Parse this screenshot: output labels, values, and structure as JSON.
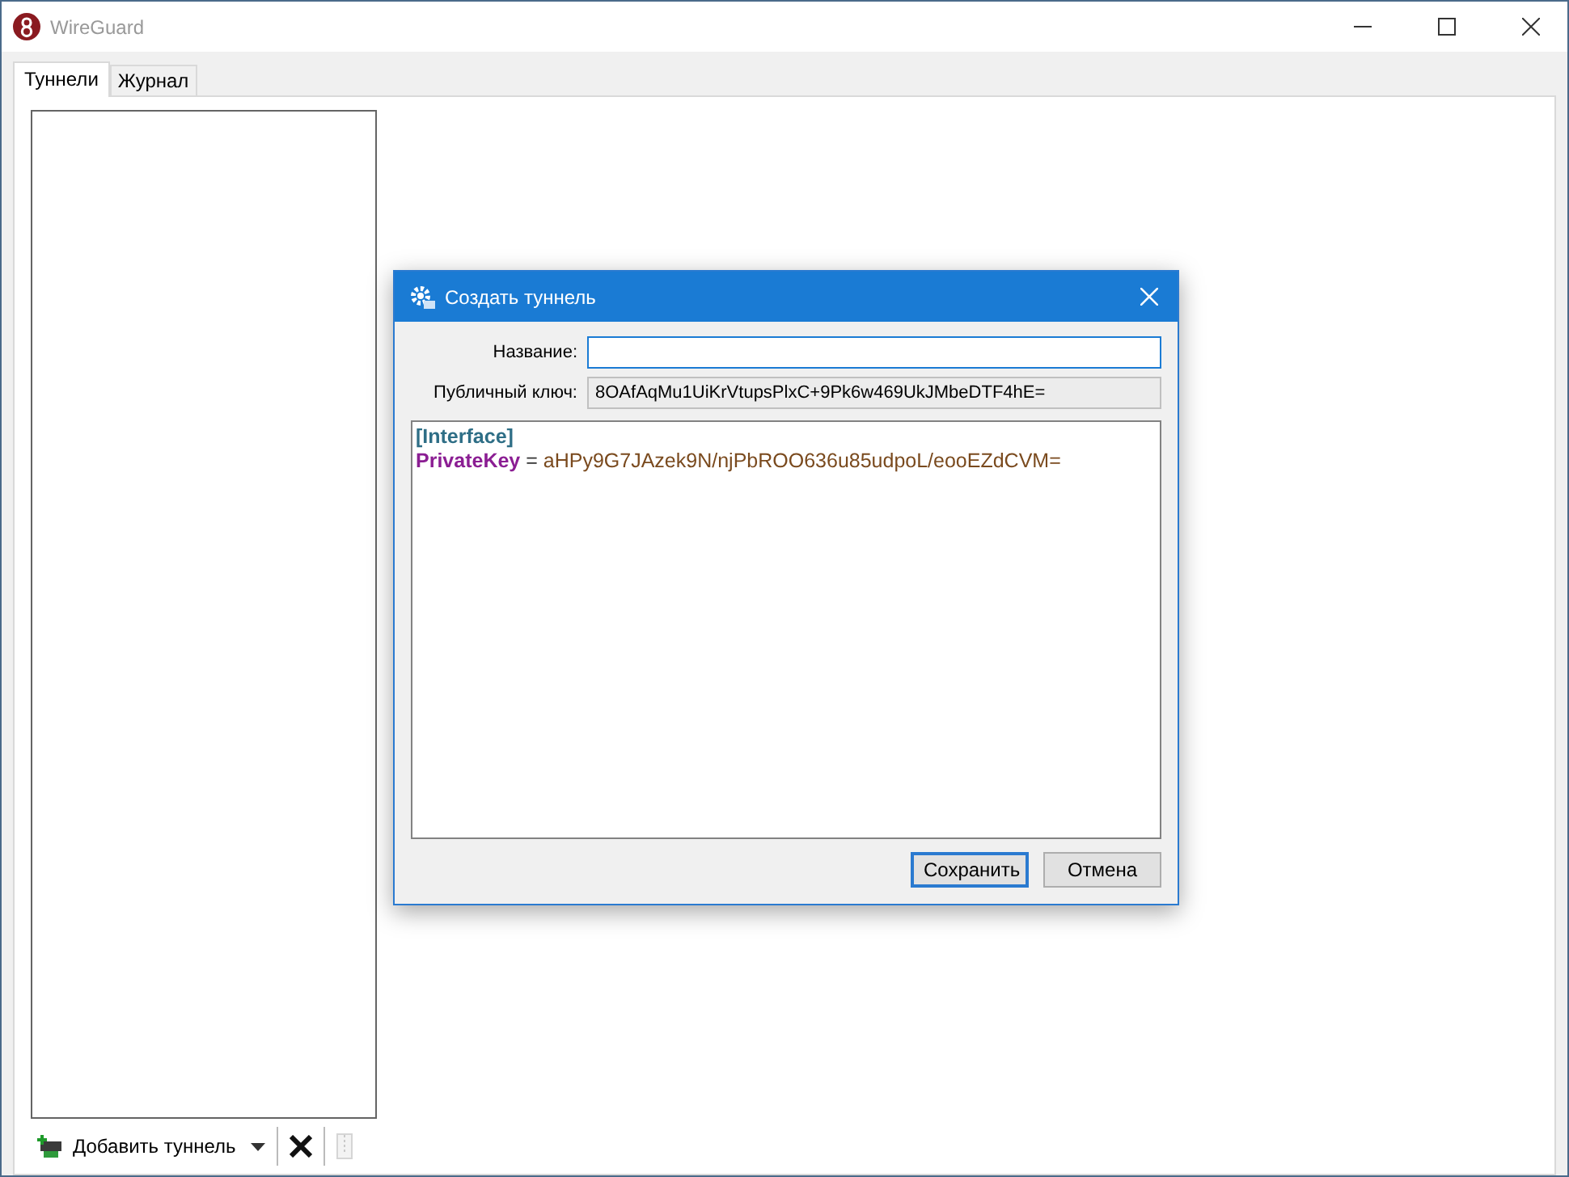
{
  "window": {
    "title": "WireGuard"
  },
  "tabs": [
    {
      "label": "Туннели",
      "selected": true
    },
    {
      "label": "Журнал",
      "selected": false
    }
  ],
  "toolbar": {
    "add_button": {
      "label": "Добавить туннель"
    },
    "export_disabled": true
  },
  "dialog": {
    "title": "Создать туннель",
    "fields": [
      {
        "label": "Название:",
        "readonly": false
      },
      {
        "label": "Публичный ключ:",
        "value": "8OAfAqMu1UiKrVtupsPlxC+9Pk6w469UkJMbeDTF4hE=",
        "readonly": true
      }
    ],
    "editor": [
      {
        "kind": "section",
        "text": "[Interface]"
      },
      {
        "kind": "pair",
        "key": "PrivateKey",
        "separator": "=",
        "value": "aHPy9G7JAzek9N/njPbROO636u85udpoL/eooEZdCVM="
      }
    ],
    "buttons": [
      {
        "label": "Сохранить",
        "default": true
      },
      {
        "label": "Отмена",
        "default": false
      }
    ]
  }
}
